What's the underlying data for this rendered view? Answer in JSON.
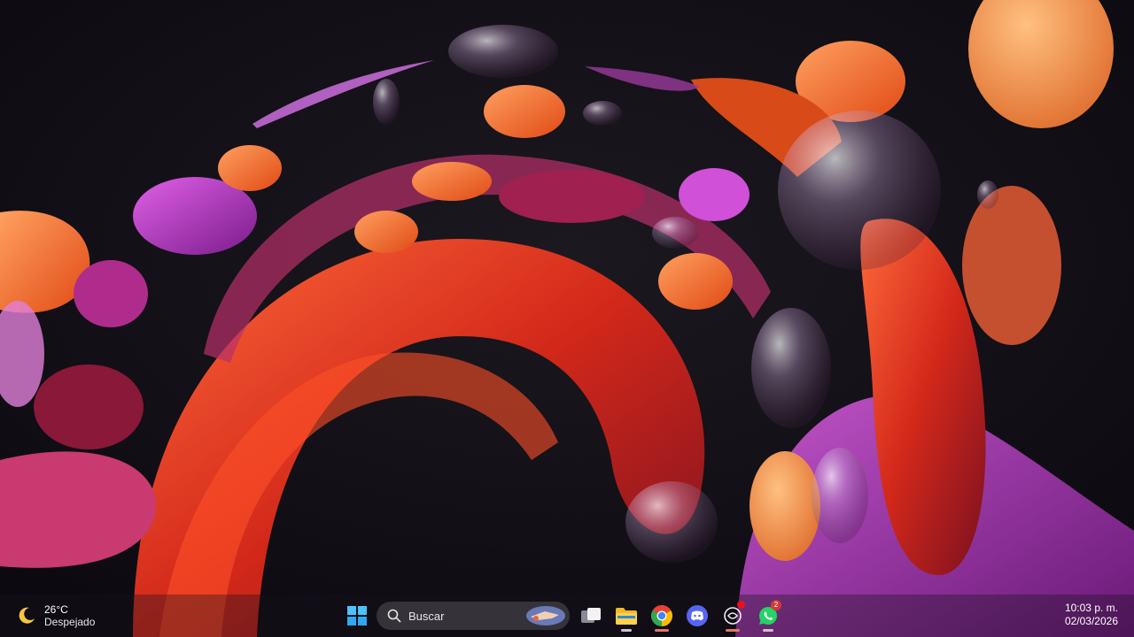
{
  "wallpaper": {
    "description_icon": "abstract-bloom-wallpaper",
    "accent": "#e0501e"
  },
  "taskbar": {
    "weather": {
      "temperature": "26°C",
      "condition": "Despejado",
      "icon": "moon-icon"
    },
    "search": {
      "placeholder": "Buscar"
    },
    "apps": [
      {
        "name": "start",
        "icon": "windows-logo-icon"
      },
      {
        "name": "task-view",
        "icon": "task-view-icon"
      },
      {
        "name": "file-explorer",
        "icon": "folder-icon"
      },
      {
        "name": "chrome",
        "icon": "chrome-icon"
      },
      {
        "name": "discord",
        "icon": "discord-icon"
      },
      {
        "name": "app",
        "icon": "app-icon"
      },
      {
        "name": "whatsapp",
        "icon": "whatsapp-icon",
        "badge": "2"
      }
    ],
    "clock": {
      "time": "10:03 p. m.",
      "date": "02/03/2026"
    }
  }
}
